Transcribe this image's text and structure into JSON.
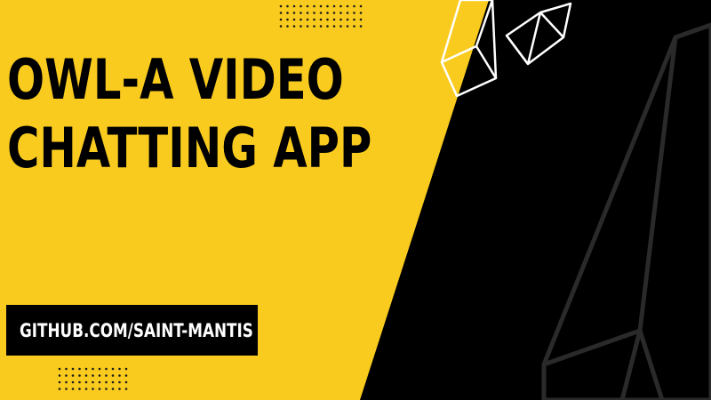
{
  "title": {
    "line1": "OWL-A VIDEO",
    "line2": "CHATTING APP"
  },
  "link": {
    "label": "GITHUB.COM/SAINT-MANTIS"
  },
  "colors": {
    "background_yellow": "#F9CB1E",
    "background_black": "#000000",
    "title_text": "#000000",
    "link_text": "#FFFFFF",
    "outline_white": "#FFFFFF",
    "outline_gray": "#2A2A2A"
  }
}
